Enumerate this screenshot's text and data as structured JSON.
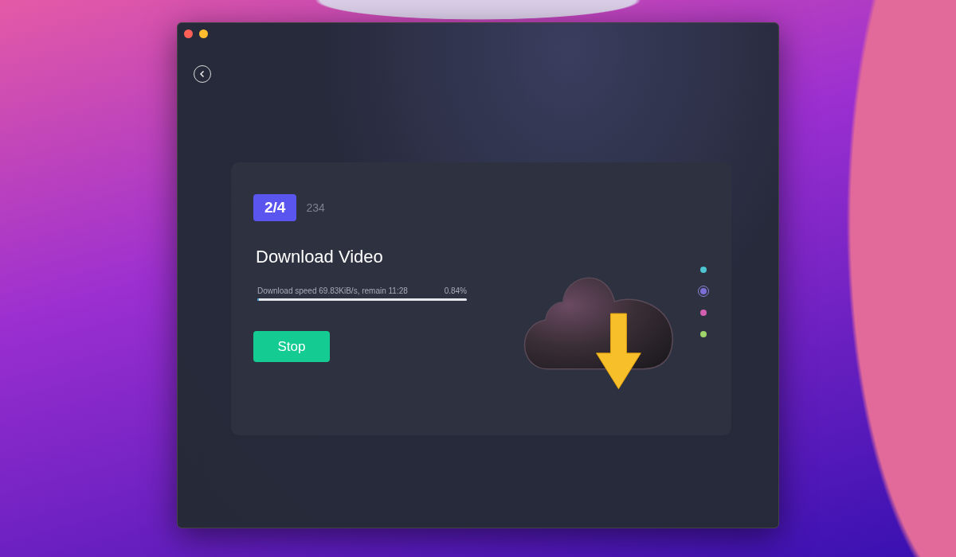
{
  "window": {
    "traffic_lights": [
      {
        "kind": "close"
      },
      {
        "kind": "minimize"
      }
    ]
  },
  "download": {
    "step_badge": "2/4",
    "count": "234",
    "title": "Download Video",
    "status": "Download speed 69.83KiB/s, remain 11:28",
    "percent": "0.84%",
    "level": 0.0084,
    "button": "Stop"
  },
  "steps": [
    {
      "color": "#4fc3d0",
      "selected": false
    },
    {
      "color": "#7b6fd6",
      "selected": true
    },
    {
      "color": "#d45fb0",
      "selected": false
    },
    {
      "color": "#9fd46a",
      "selected": false
    }
  ]
}
